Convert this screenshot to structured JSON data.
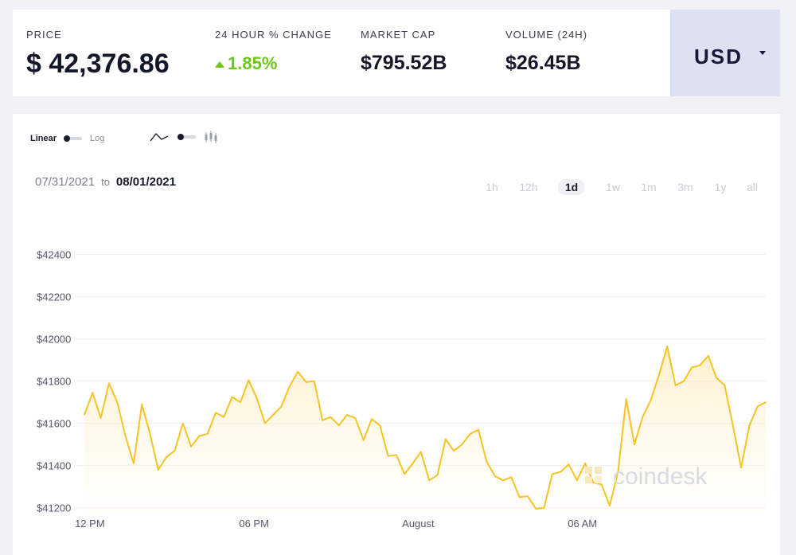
{
  "header": {
    "price_label": "PRICE",
    "price_value": "$ 42,376.86",
    "change_label": "24 HOUR % CHANGE",
    "change_value": "1.85%",
    "market_cap_label": "MARKET CAP",
    "market_cap_value": "$795.52B",
    "volume_label": "VOLUME (24H)",
    "volume_value": "$26.45B",
    "currency": "USD",
    "change_color": "#6cc716"
  },
  "controls": {
    "scale_linear": "Linear",
    "scale_log": "Log",
    "date_from": "07/31/2021",
    "date_to_word": "to",
    "date_to": "08/01/2021",
    "ranges": [
      "1h",
      "12h",
      "1d",
      "1w",
      "1m",
      "3m",
      "1y",
      "all"
    ],
    "active_range": "1d"
  },
  "watermark": "coindesk",
  "chart_data": {
    "type": "line",
    "line_color": "#f7c325",
    "y_ticks": [
      "$42400",
      "$42200",
      "$42000",
      "$41800",
      "$41600",
      "$41400",
      "$41200"
    ],
    "y_tick_values": [
      42400,
      42200,
      42000,
      41800,
      41600,
      41400,
      41200
    ],
    "x_ticks": [
      "12 PM",
      "06 PM",
      "August",
      "06 AM"
    ],
    "x_tick_hours": [
      12,
      18,
      24,
      30
    ],
    "ylim": [
      41180,
      42500
    ],
    "x_hours": [
      11.8,
      12.1,
      12.4,
      12.7,
      13.0,
      13.3,
      13.6,
      13.9,
      14.2,
      14.5,
      14.8,
      15.1,
      15.4,
      15.7,
      16.0,
      16.3,
      16.6,
      16.9,
      17.2,
      17.5,
      17.8,
      18.1,
      18.4,
      18.7,
      19.0,
      19.3,
      19.6,
      19.9,
      20.2,
      20.5,
      20.8,
      21.1,
      21.4,
      21.7,
      22.0,
      22.3,
      22.6,
      22.9,
      23.2,
      23.5,
      23.8,
      24.1,
      24.4,
      24.7,
      25.0,
      25.3,
      25.6,
      25.9,
      26.2,
      26.5,
      26.8,
      27.1,
      27.4,
      27.7,
      28.0,
      28.3,
      28.6,
      28.9,
      29.2,
      29.5,
      29.8,
      30.1,
      30.4,
      30.7,
      31.0,
      31.3,
      31.6,
      31.9,
      32.2,
      32.5,
      32.8,
      33.1,
      33.4,
      33.7,
      34.0,
      34.3,
      34.6,
      34.9,
      35.2,
      35.5,
      35.8,
      36.1,
      36.4,
      36.7
    ],
    "values": [
      41640,
      41745,
      41625,
      41790,
      41700,
      41540,
      41410,
      41690,
      41550,
      41380,
      41440,
      41470,
      41600,
      41490,
      41540,
      41550,
      41650,
      41630,
      41725,
      41700,
      41805,
      41720,
      41600,
      41640,
      41680,
      41775,
      41845,
      41795,
      41800,
      41615,
      41630,
      41590,
      41640,
      41625,
      41520,
      41620,
      41590,
      41445,
      41450,
      41360,
      41410,
      41465,
      41330,
      41355,
      41525,
      41470,
      41500,
      41550,
      41570,
      41420,
      41350,
      41330,
      41345,
      41250,
      41255,
      41195,
      41200,
      41360,
      41370,
      41405,
      41330,
      41410,
      41320,
      41310,
      41210,
      41370,
      41715,
      41500,
      41630,
      41710,
      41830,
      41965,
      41780,
      41800,
      41865,
      41875,
      41920,
      41815,
      41780,
      41590,
      41390,
      41590,
      41680,
      41700
    ]
  }
}
